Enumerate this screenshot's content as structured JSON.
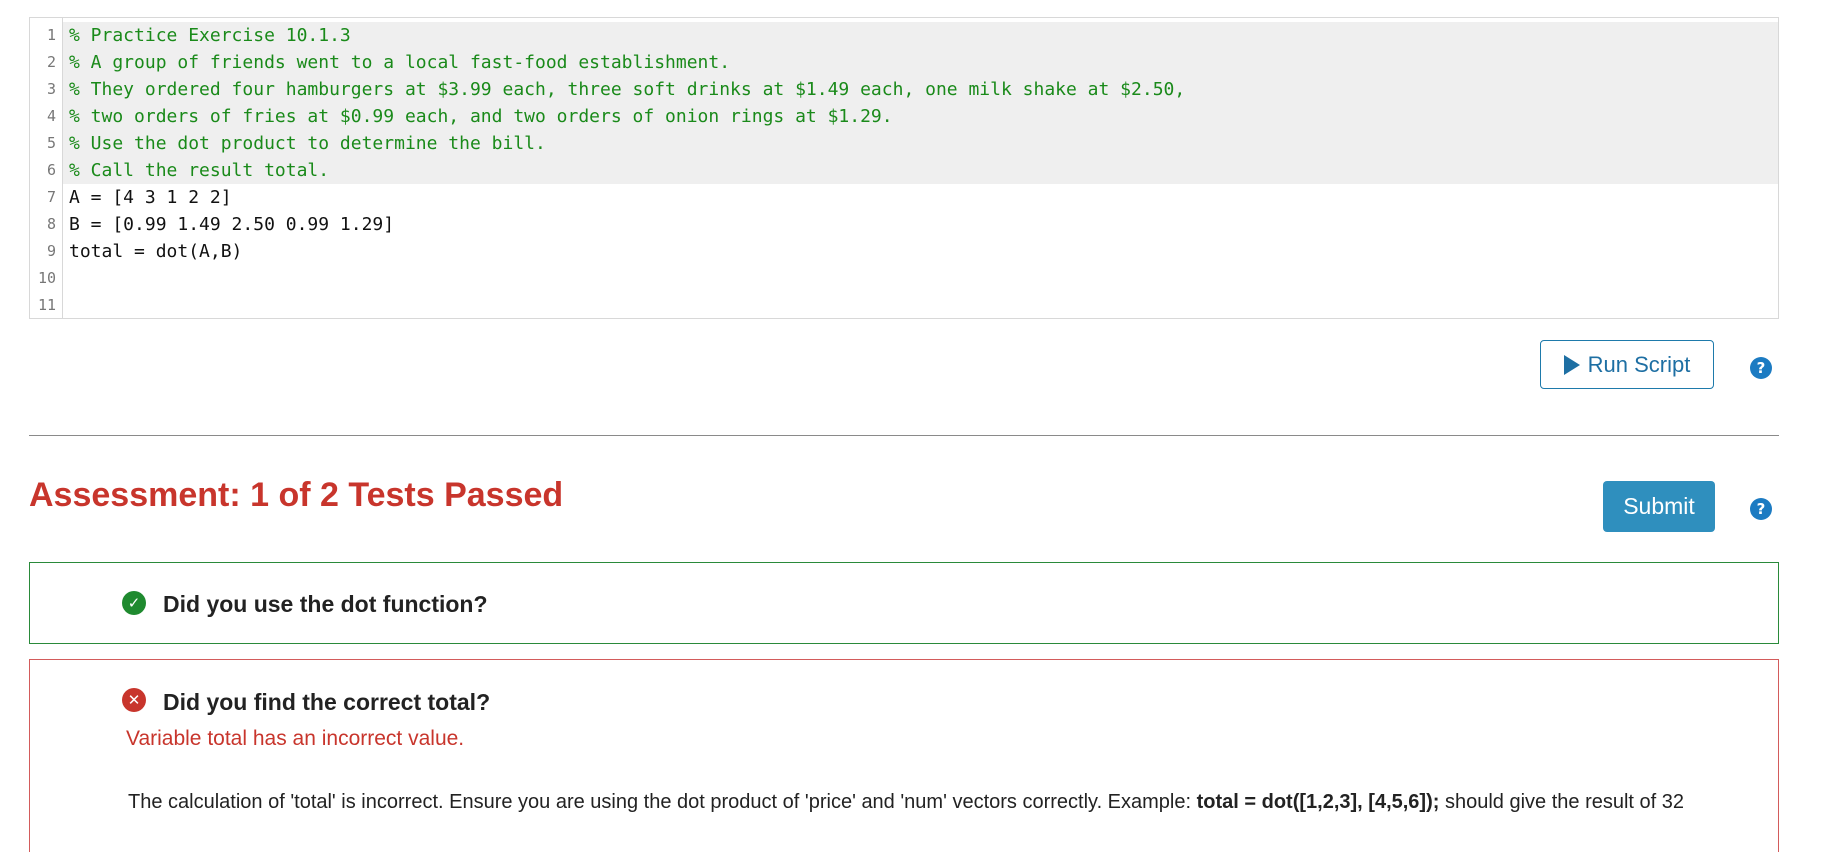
{
  "editor": {
    "lines": [
      {
        "num": "1",
        "text": "% Practice Exercise 10.1.3"
      },
      {
        "num": "2",
        "text": "% A group of friends went to a local fast-food establishment."
      },
      {
        "num": "3",
        "text": "% They ordered four hamburgers at $3.99 each, three soft drinks at $1.49 each, one milk shake at $2.50,"
      },
      {
        "num": "4",
        "text": "% two orders of fries at $0.99 each, and two orders of onion rings at $1.29."
      },
      {
        "num": "5",
        "text": "% Use the dot product to determine the bill."
      },
      {
        "num": "6",
        "text": "% Call the result total."
      },
      {
        "num": "7",
        "text": "A = [4 3 1 2 2]"
      },
      {
        "num": "8",
        "text": "B = [0.99 1.49 2.50 0.99 1.29]"
      },
      {
        "num": "9",
        "text": "total = dot(A,B)"
      },
      {
        "num": "10",
        "text": ""
      },
      {
        "num": "11",
        "text": ""
      }
    ]
  },
  "toolbar": {
    "run_label": "Run Script",
    "help_glyph": "?"
  },
  "assessment": {
    "title": "Assessment: 1 of 2 Tests Passed",
    "submit_label": "Submit",
    "help_glyph": "?"
  },
  "tests": [
    {
      "status": "pass",
      "status_glyph": "✓",
      "label": "Did you use the dot function?"
    },
    {
      "status": "fail",
      "status_glyph": "✕",
      "label": "Did you find the correct total?",
      "message": "Variable total has an incorrect value.",
      "detail_prefix": "The calculation of 'total' is incorrect. Ensure you are using the dot product of 'price' and 'num' vectors correctly. Example: ",
      "detail_code": "total = dot([1,2,3], [4,5,6]);",
      "detail_suffix": " should give the result of 32"
    }
  ],
  "colors": {
    "error_red": "#c8352c",
    "pass_green": "#1f8a2f",
    "link_blue": "#1e6fa3",
    "submit_blue": "#2f8fbe",
    "comment_green": "#1a8a1a"
  }
}
